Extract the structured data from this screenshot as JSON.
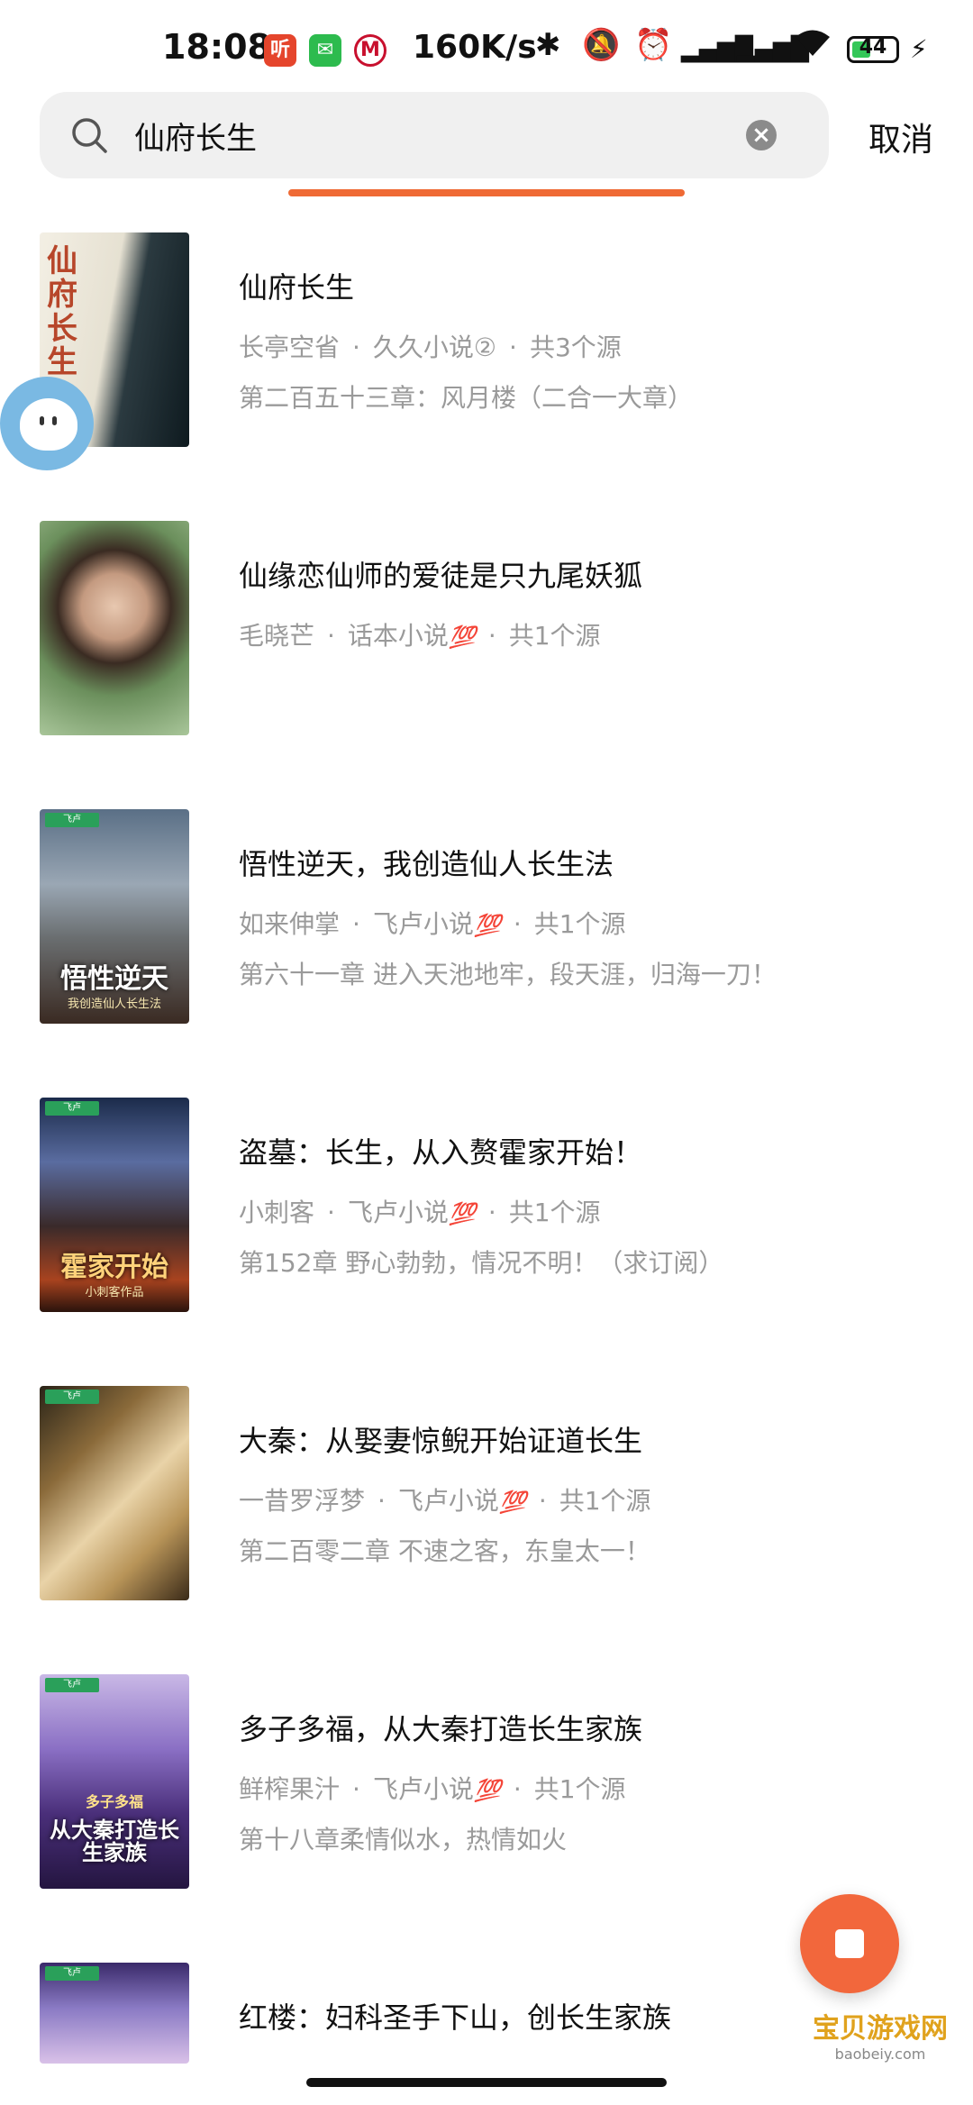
{
  "status_bar": {
    "time": "18:08",
    "app_badge_1": "听",
    "net_speed": "160K/s",
    "battery_level": "44",
    "battery_fraction": 0.44
  },
  "search": {
    "query": "仙府长生",
    "cancel_label": "取消"
  },
  "colors": {
    "accent": "#ef6a35",
    "meta_gray": "#9a9a9a",
    "badge_red": "#e5452c"
  },
  "results": [
    {
      "title": "仙府长生",
      "author": "长亭空省",
      "source": "久久小说②",
      "count": "共3个源",
      "chapter": "第二百五十三章：风月楼（二合一大章）",
      "cover_text": "仙府长生",
      "cover_sub": "",
      "badge": ""
    },
    {
      "title": "仙缘恋仙师的爱徒是只九尾妖狐",
      "author": "毛晓芒",
      "source": "话本小说",
      "count": "共1个源",
      "chapter": "",
      "cover_text": "",
      "cover_sub": "",
      "badge": "💯"
    },
    {
      "title": "悟性逆天，我创造仙人长生法",
      "author": "如来伸掌",
      "source": "飞卢小说",
      "count": "共1个源",
      "chapter": "第六十一章 进入天池地牢，段天涯，归海一刀！",
      "cover_text": "悟性逆天",
      "cover_sub": "我创造仙人长生法",
      "badge": "💯"
    },
    {
      "title": "盗墓：长生，从入赘霍家开始！",
      "author": "小刺客",
      "source": "飞卢小说",
      "count": "共1个源",
      "chapter": "第152章 野心勃勃，情况不明！（求订阅）",
      "cover_text": "霍家开始",
      "cover_sub": "小刺客作品",
      "badge": "💯"
    },
    {
      "title": "大秦：从娶妻惊鲵开始证道长生",
      "author": "一昔罗浮梦",
      "source": "飞卢小说",
      "count": "共1个源",
      "chapter": "第二百零二章 不速之客，东皇太一！",
      "cover_text": "",
      "cover_sub": "",
      "badge": "💯"
    },
    {
      "title": "多子多福，从大秦打造长生家族",
      "author": "鲜榨果汁",
      "source": "飞卢小说",
      "count": "共1个源",
      "chapter": "第十八章柔情似水，热情如火",
      "cover_text": "从大秦打造长生家族",
      "cover_sub": "多子多福",
      "badge": "💯"
    },
    {
      "title": "红楼：妇科圣手下山，创长生家族",
      "author": "",
      "source": "",
      "count": "",
      "chapter": "",
      "cover_text": "",
      "cover_sub": "",
      "badge": ""
    }
  ],
  "watermark": {
    "text": "宝贝游戏网",
    "url": "baobeiy.com"
  }
}
